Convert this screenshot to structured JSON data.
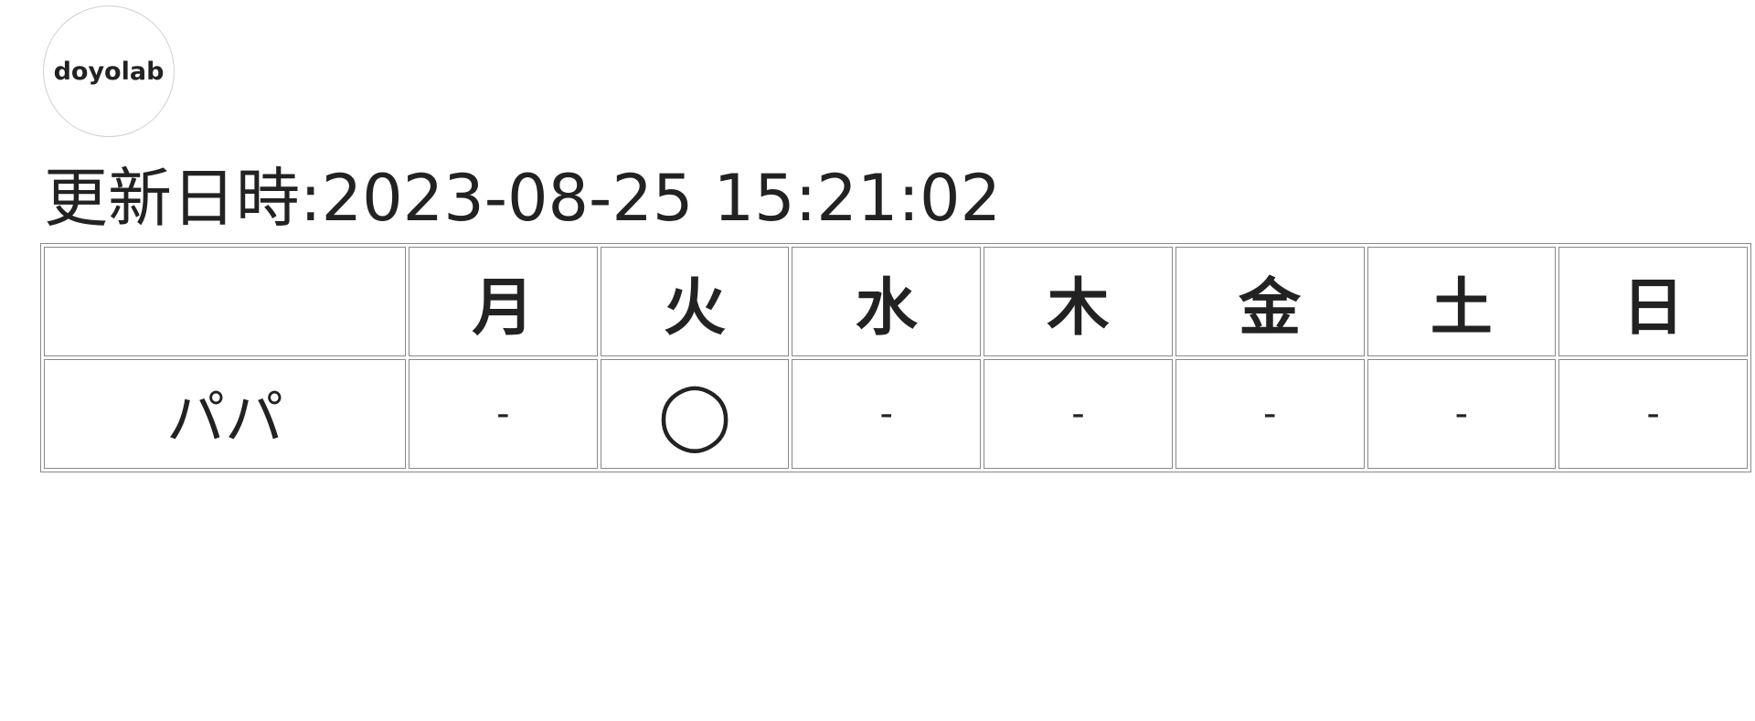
{
  "logo": {
    "text": "doyolab"
  },
  "updated": {
    "text": "更新日時:2023-08-25 15:21:02"
  },
  "table": {
    "corner_label": "",
    "days": [
      "月",
      "火",
      "水",
      "木",
      "金",
      "土",
      "日"
    ],
    "rows": [
      {
        "name": "パパ",
        "statuses": [
          "-",
          "◯",
          "-",
          "-",
          "-",
          "-",
          "-"
        ]
      }
    ]
  }
}
